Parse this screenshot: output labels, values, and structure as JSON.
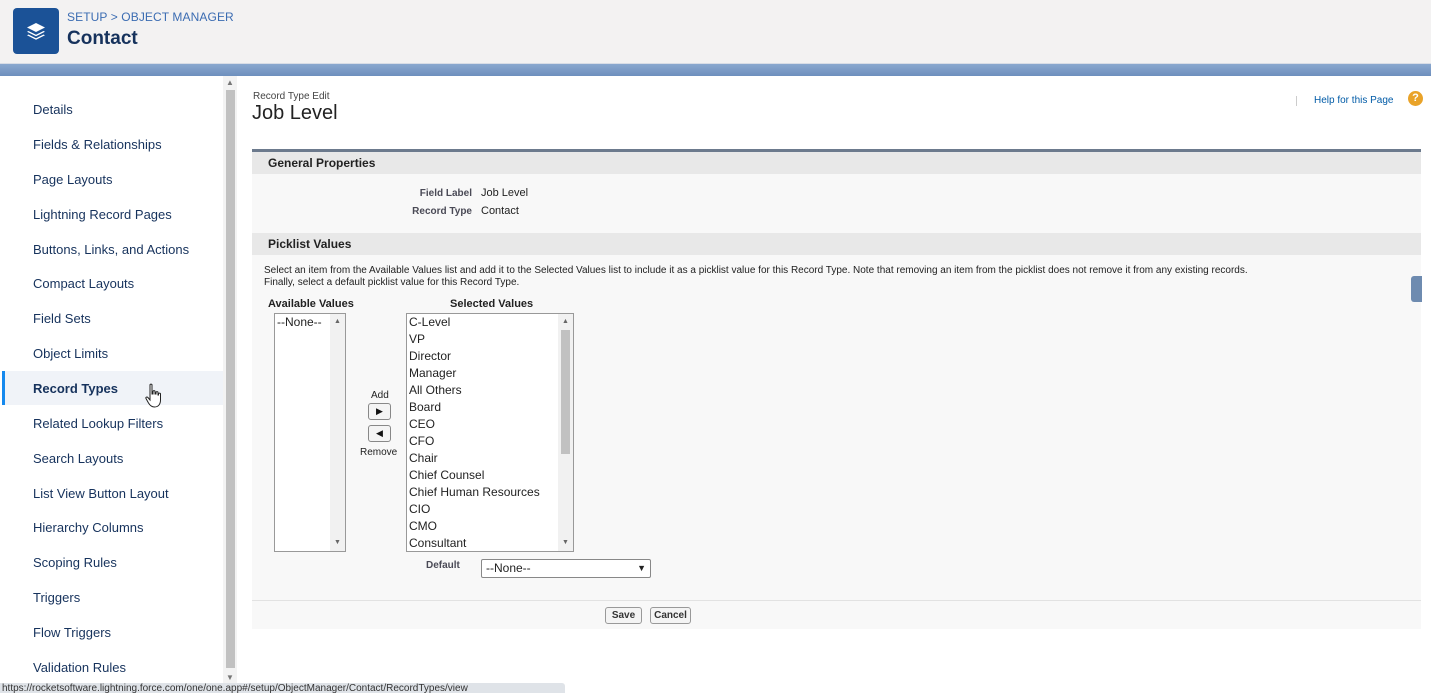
{
  "header": {
    "breadcrumb_setup": "SETUP",
    "breadcrumb_sep": ">",
    "breadcrumb_object_manager": "OBJECT MANAGER",
    "title": "Contact",
    "icon": "layers-icon"
  },
  "sidebar": {
    "items": [
      {
        "label": "Details"
      },
      {
        "label": "Fields & Relationships"
      },
      {
        "label": "Page Layouts"
      },
      {
        "label": "Lightning Record Pages"
      },
      {
        "label": "Buttons, Links, and Actions"
      },
      {
        "label": "Compact Layouts"
      },
      {
        "label": "Field Sets"
      },
      {
        "label": "Object Limits"
      },
      {
        "label": "Record Types",
        "active": true
      },
      {
        "label": "Related Lookup Filters"
      },
      {
        "label": "Search Layouts"
      },
      {
        "label": "List View Button Layout"
      },
      {
        "label": "Hierarchy Columns"
      },
      {
        "label": "Scoping Rules"
      },
      {
        "label": "Triggers"
      },
      {
        "label": "Flow Triggers"
      },
      {
        "label": "Validation Rules"
      }
    ]
  },
  "main": {
    "subtitle": "Record Type Edit",
    "title": "Job Level",
    "help_link": "Help for this Page",
    "help_icon": "?",
    "general_properties": {
      "heading": "General Properties",
      "field_label_label": "Field Label",
      "field_label_value": "Job Level",
      "record_type_label": "Record Type",
      "record_type_value": "Contact"
    },
    "picklist": {
      "heading": "Picklist Values",
      "instructions_line1": "Select an item from the Available Values list and add it to the Selected Values list to include it as a picklist value for this Record Type. Note that removing an item from the picklist does not remove it from any existing records.",
      "instructions_line2": "Finally, select a default picklist value for this Record Type.",
      "available_label": "Available Values",
      "selected_label": "Selected Values",
      "available_values": [
        "--None--"
      ],
      "selected_values": [
        "C-Level",
        "VP",
        "Director",
        "Manager",
        "All Others",
        "Board",
        "CEO",
        "CFO",
        "Chair",
        "Chief Counsel",
        "Chief Human Resources",
        "CIO",
        "CMO",
        "Consultant"
      ],
      "add_label": "Add",
      "remove_label": "Remove",
      "default_label": "Default",
      "default_value": "--None--"
    },
    "buttons": {
      "save": "Save",
      "cancel": "Cancel"
    }
  },
  "statusbar": {
    "url": "https://rocketsoftware.lightning.force.com/one/one.app#/setup/ObjectManager/Contact/RecordTypes/view"
  }
}
